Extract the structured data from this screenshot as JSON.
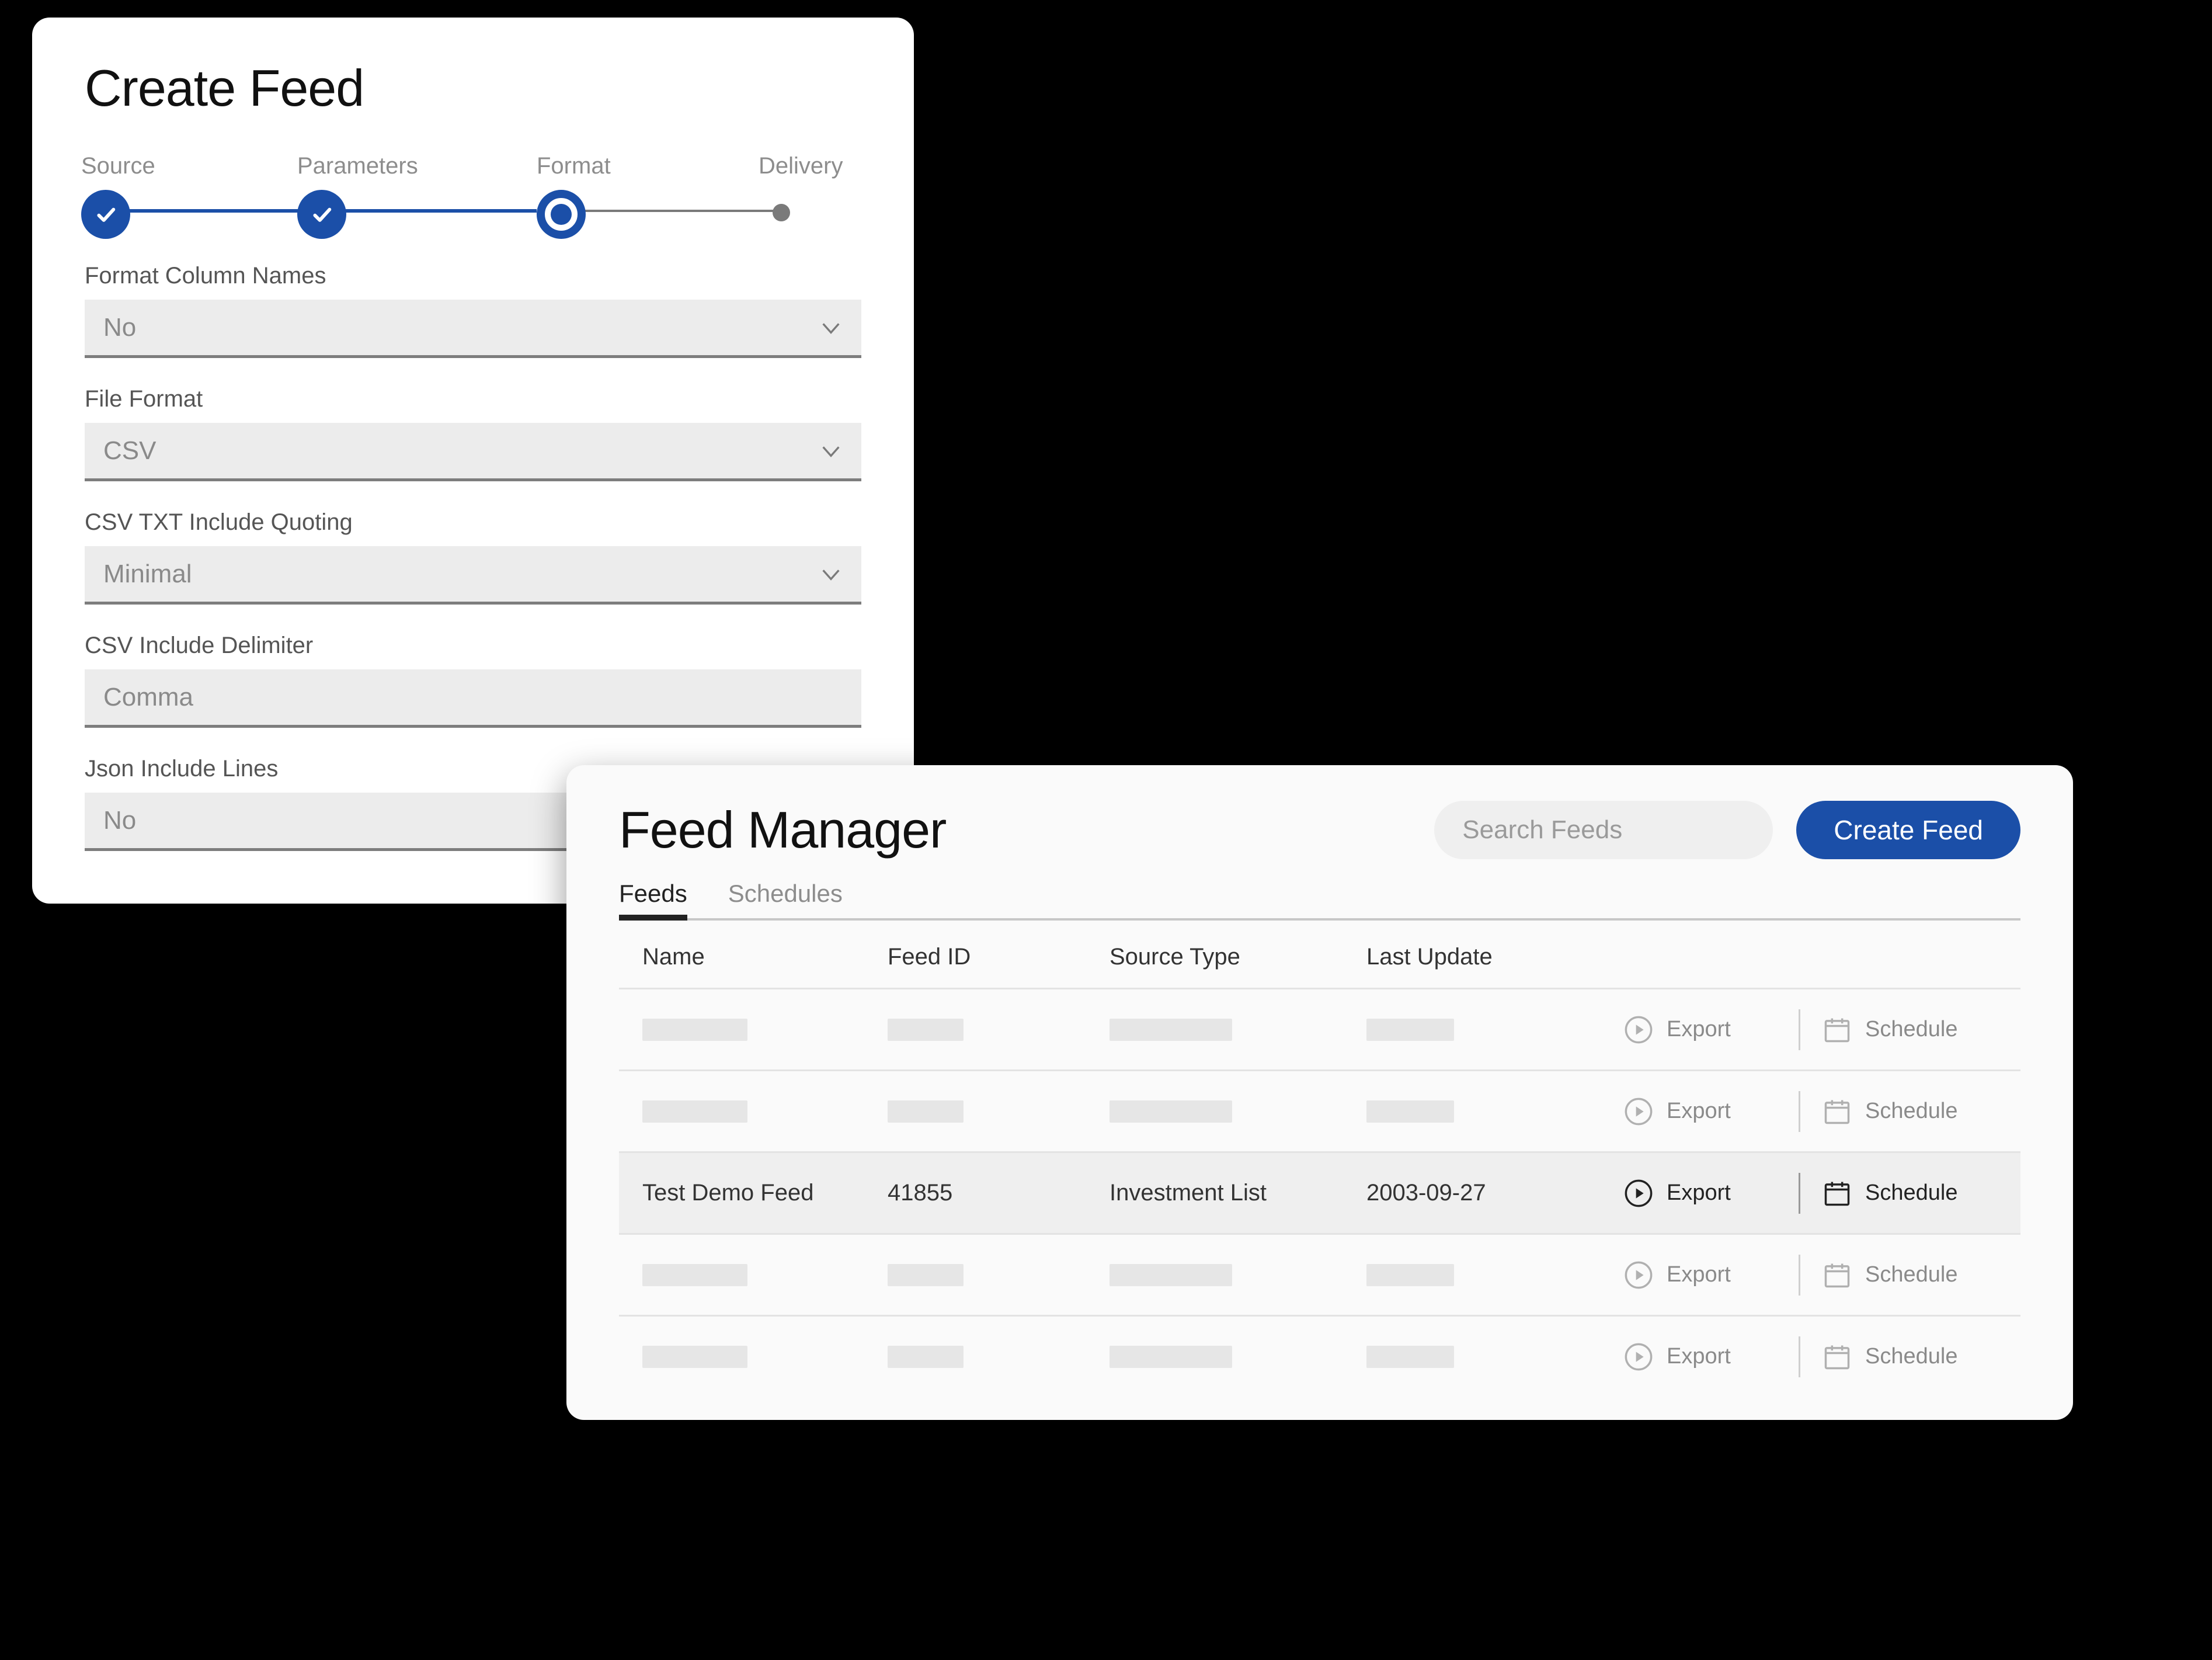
{
  "create_feed": {
    "title": "Create Feed",
    "steps": {
      "source": "Source",
      "parameters": "Parameters",
      "format": "Format",
      "delivery": "Delivery"
    },
    "fields": {
      "format_column_names": {
        "label": "Format Column Names",
        "value": "No"
      },
      "file_format": {
        "label": "File Format",
        "value": "CSV"
      },
      "csv_quoting": {
        "label": "CSV TXT Include Quoting",
        "value": "Minimal"
      },
      "csv_delimiter": {
        "label": "CSV Include Delimiter",
        "value": "Comma"
      },
      "json_lines": {
        "label": "Json Include Lines",
        "value": "No"
      }
    }
  },
  "manager": {
    "title": "Feed Manager",
    "search_placeholder": "Search Feeds",
    "create_button": "Create Feed",
    "tabs": {
      "feeds": "Feeds",
      "schedules": "Schedules"
    },
    "columns": {
      "name": "Name",
      "feed_id": "Feed ID",
      "source_type": "Source Type",
      "last_update": "Last Update"
    },
    "actions": {
      "export": "Export",
      "schedule": "Schedule"
    },
    "active_row": {
      "name": "Test Demo Feed",
      "feed_id": "41855",
      "source_type": "Investment List",
      "last_update": "2003-09-27"
    }
  },
  "colors": {
    "primary": "#1b4fa8"
  }
}
